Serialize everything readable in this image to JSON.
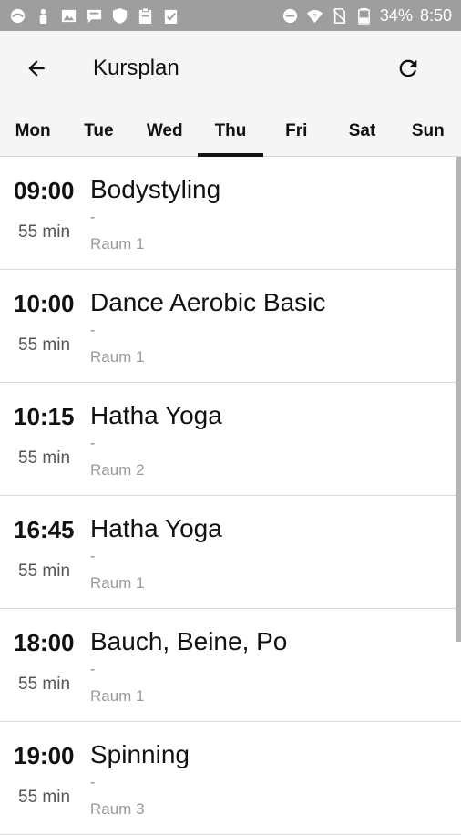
{
  "status_bar": {
    "battery": "34%",
    "time": "8:50",
    "left_icons": [
      "app-icon",
      "person-icon",
      "image-icon",
      "message-icon",
      "shield-icon",
      "clipboard-icon",
      "clipboard-check-icon"
    ],
    "right_icons": [
      "do-not-disturb-icon",
      "wifi-icon",
      "no-sim-icon",
      "battery-icon"
    ]
  },
  "app_bar": {
    "title": "Kursplan",
    "back_icon": "arrow-back-icon",
    "refresh_icon": "refresh-icon"
  },
  "tabs": [
    {
      "label": "Mon"
    },
    {
      "label": "Tue"
    },
    {
      "label": "Wed"
    },
    {
      "label": "Thu"
    },
    {
      "label": "Fri"
    },
    {
      "label": "Sat"
    },
    {
      "label": "Sun"
    }
  ],
  "active_tab": "Thu",
  "courses": [
    {
      "time": "09:00",
      "duration": "55 min",
      "name": "Bodystyling",
      "detail": "-",
      "room": "Raum 1"
    },
    {
      "time": "10:00",
      "duration": "55 min",
      "name": "Dance Aerobic Basic",
      "detail": "-",
      "room": "Raum 1"
    },
    {
      "time": "10:15",
      "duration": "55 min",
      "name": "Hatha Yoga",
      "detail": "-",
      "room": "Raum 2"
    },
    {
      "time": "16:45",
      "duration": "55 min",
      "name": "Hatha Yoga",
      "detail": "-",
      "room": "Raum 1"
    },
    {
      "time": "18:00",
      "duration": "55 min",
      "name": "Bauch, Beine, Po",
      "detail": "-",
      "room": "Raum 1"
    },
    {
      "time": "19:00",
      "duration": "55 min",
      "name": "Spinning",
      "detail": "-",
      "room": "Raum 3"
    }
  ],
  "colors": {
    "status_bar": "#9e9e9e",
    "app_bar": "#f5f5f5",
    "text_primary": "#111111",
    "text_secondary": "#9a9a9a"
  }
}
